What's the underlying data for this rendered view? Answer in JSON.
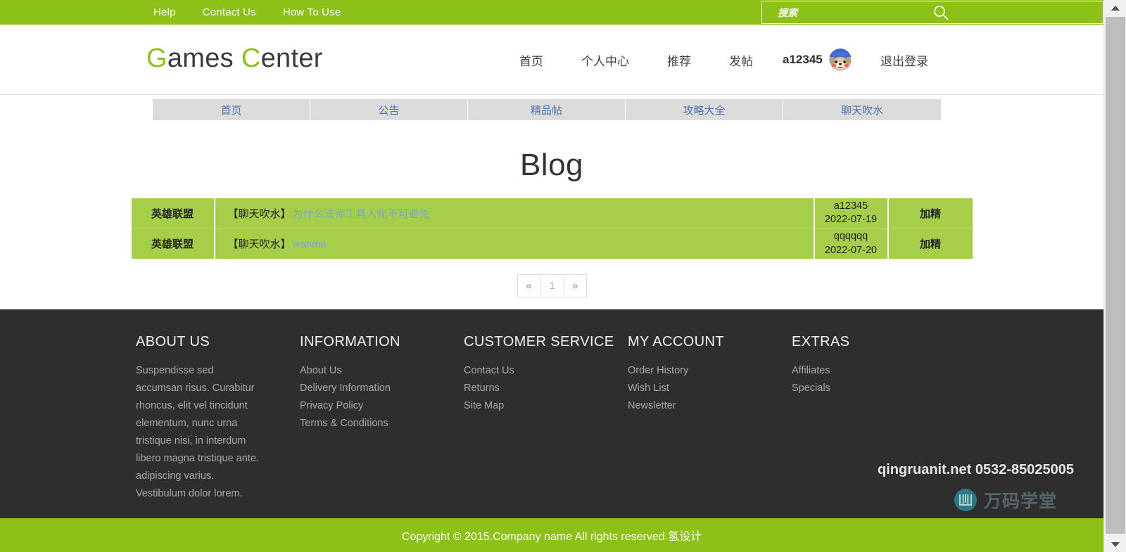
{
  "topbar": {
    "links": [
      {
        "label": "Help"
      },
      {
        "label": "Contact Us"
      },
      {
        "label": "How To Use"
      }
    ],
    "search": {
      "placeholder": "搜索",
      "value": "",
      "icon": "search-icon"
    }
  },
  "masthead": {
    "logo": {
      "first_letter": "G",
      "first_rest": "ames ",
      "second_letter": "C",
      "second_rest": "enter",
      "accent_color": "#8CC117"
    },
    "nav": [
      {
        "label": "首页"
      },
      {
        "label": "个人中心"
      },
      {
        "label": "推荐"
      },
      {
        "label": "发帖"
      }
    ],
    "user": {
      "name": "a12345",
      "avatar_icon": "user-avatar-dog"
    },
    "logout_label": "退出登录"
  },
  "tabbar": {
    "tabs": [
      {
        "label": "首页"
      },
      {
        "label": "公告"
      },
      {
        "label": "精品帖"
      },
      {
        "label": "攻略大全"
      },
      {
        "label": "聊天吹水"
      }
    ],
    "background": "#dcdcdc",
    "text_color": "#4b6fa8"
  },
  "main": {
    "page_title": "Blog",
    "table": {
      "row_background": "#A6CE48",
      "rows": [
        {
          "category": "英雄联盟",
          "title_prefix": "【聊天吹水】",
          "title_link": "为什么法师工具人化不可避免",
          "author": "a12345",
          "date": "2022-07-19",
          "action": "加精"
        },
        {
          "category": "英雄联盟",
          "title_prefix": "【聊天吹水】",
          "title_link": "wanma",
          "author": "qqqqqq",
          "date": "2022-07-20",
          "action": "加精"
        }
      ]
    },
    "pagination": {
      "prev": "«",
      "pages": [
        "1"
      ],
      "next": "»",
      "current": "1"
    }
  },
  "footer": {
    "columns": [
      {
        "heading": "ABOUT US",
        "text": "Suspendisse sed accumsan risus. Curabitur rhoncus, elit vel tincidunt elementum, nunc urna tristique nisi, in interdum libero magna tristique ante. adipiscing varius. Vestibulum dolor lorem.",
        "links": []
      },
      {
        "heading": "INFORMATION",
        "text": "",
        "links": [
          "About Us",
          "Delivery Information",
          "Privacy Policy",
          "Terms & Conditions"
        ]
      },
      {
        "heading": "CUSTOMER SERVICE",
        "text": "",
        "links": [
          "Contact Us",
          "Returns",
          "Site Map"
        ]
      },
      {
        "heading": "MY ACCOUNT",
        "text": "",
        "links": [
          "Order History",
          "Wish List",
          "Newsletter"
        ]
      },
      {
        "heading": "EXTRAS",
        "text": "",
        "links": [
          "Affiliates",
          "Specials"
        ]
      }
    ],
    "contact": "qingruanit.net 0532-85025005",
    "watermark": {
      "text": "万码学堂",
      "icon": "wanma-logo-icon"
    },
    "background": "#2e2e2e"
  },
  "copyright": {
    "text": "Copyright © 2015.Company name All rights reserved.氢设计",
    "background": "#8CC117"
  },
  "scrollbar": {
    "up_icon": "scroll-up-arrow-icon",
    "down_icon": "scroll-down-arrow-icon"
  }
}
